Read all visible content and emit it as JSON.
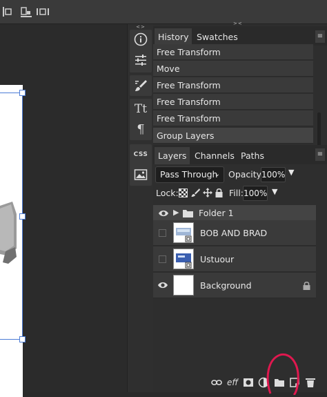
{
  "toolbar": {
    "icons": [
      "align-left-icon",
      "align-bottom-icon",
      "distribute-icon"
    ]
  },
  "tools_panel": {
    "collapse_label": "<>",
    "tools": [
      {
        "name": "info-icon",
        "glyph": "i"
      },
      {
        "name": "adjust-sliders-icon",
        "glyph": "≡"
      },
      {
        "name": "brush-icon",
        "glyph": "✎"
      },
      {
        "name": "text-tool-icon",
        "glyph": "Tt"
      },
      {
        "name": "paragraph-icon",
        "glyph": "¶"
      },
      {
        "name": "css-icon",
        "glyph": "CSS"
      },
      {
        "name": "image-icon",
        "glyph": "▣"
      }
    ]
  },
  "history_panel": {
    "collapse_label": "><",
    "tabs": [
      "History",
      "Swatches"
    ],
    "items": [
      "Free Transform",
      "Move",
      "Free Transform",
      "Free Transform",
      "Free Transform",
      "Group Layers"
    ]
  },
  "layers_panel": {
    "tabs": [
      "Layers",
      "Channels",
      "Paths"
    ],
    "blend_mode": "Pass Through",
    "opacity_label": "Opacity:",
    "opacity_value": "100%",
    "lock_label": "Lock:",
    "fill_label": "Fill:",
    "fill_value": "100%",
    "layers": [
      {
        "name": "Folder 1",
        "type": "folder",
        "visible": true
      },
      {
        "name": "BOB AND BRAD",
        "type": "smart",
        "visible": false
      },
      {
        "name": "Ustuour",
        "type": "smart",
        "visible": false
      },
      {
        "name": "Background",
        "type": "background",
        "visible": true,
        "locked": true
      }
    ],
    "bottom_icons": [
      "link-icon",
      "effects-icon",
      "mask-icon",
      "adjustment-icon",
      "new-folder-icon",
      "new-layer-icon",
      "trash-icon"
    ],
    "effects_label": "eff"
  },
  "colors": {
    "selection": "#4a7bd6",
    "annotation_circle": "#e0184f"
  }
}
